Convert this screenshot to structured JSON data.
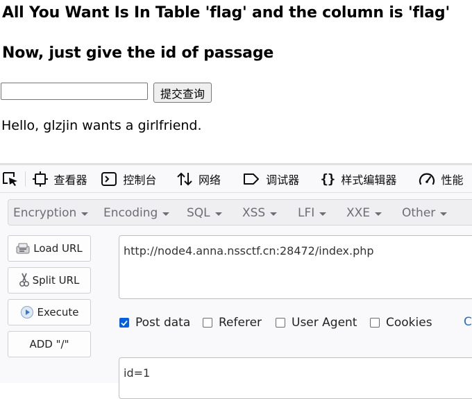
{
  "page": {
    "heading1": "All You Want Is In Table 'flag' and the column is 'flag'",
    "heading2": "Now, just give the id of passage",
    "id_input_value": "",
    "submit_label": "提交查询",
    "message": "Hello, glzjin wants a girlfriend."
  },
  "devtools": {
    "tabs": [
      {
        "label": "查看器",
        "icon": "inspector-icon"
      },
      {
        "label": "控制台",
        "icon": "console-icon"
      },
      {
        "label": "网络",
        "icon": "network-icon"
      },
      {
        "label": "调试器",
        "icon": "debugger-icon"
      },
      {
        "label": "样式编辑器",
        "icon": "style-editor-icon"
      },
      {
        "label": "性能",
        "icon": "performance-icon"
      }
    ]
  },
  "hackbar": {
    "menu": [
      "Encryption",
      "Encoding",
      "SQL",
      "XSS",
      "LFI",
      "XXE",
      "Other"
    ],
    "buttons": [
      {
        "label": "Load URL",
        "icon": "load-url-icon"
      },
      {
        "label": "Split URL",
        "icon": "split-url-icon"
      },
      {
        "label": "Execute",
        "icon": "execute-icon"
      },
      {
        "label": "ADD \"/\""
      }
    ],
    "url": "http://node4.anna.nssctf.cn:28472/index.php",
    "options": [
      {
        "label": "Post data",
        "checked": true
      },
      {
        "label": "Referer",
        "checked": false
      },
      {
        "label": "User Agent",
        "checked": false
      },
      {
        "label": "Cookies",
        "checked": false
      }
    ],
    "clear_label": "C",
    "post_body": "id=1"
  },
  "colors": {
    "accent": "#0060df",
    "link": "#2a6cc7"
  }
}
